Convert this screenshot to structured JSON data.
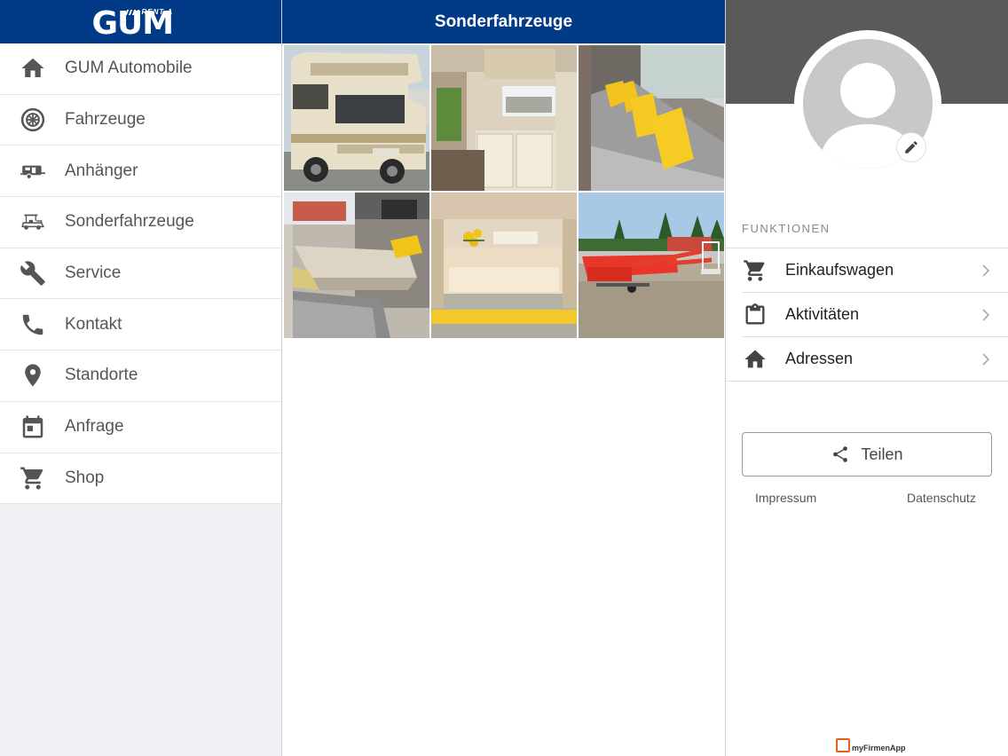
{
  "sidebar": {
    "logo": {
      "brand": "GUM",
      "tagline": "RENT A"
    },
    "items": [
      {
        "label": "GUM Automobile",
        "icon": "home-icon"
      },
      {
        "label": "Fahrzeuge",
        "icon": "wheel-icon"
      },
      {
        "label": "Anhänger",
        "icon": "trailer-icon"
      },
      {
        "label": "Sonderfahrzeuge",
        "icon": "golf-cart-icon"
      },
      {
        "label": "Service",
        "icon": "wrench-icon"
      },
      {
        "label": "Kontakt",
        "icon": "phone-icon"
      },
      {
        "label": "Standorte",
        "icon": "location-pin-icon"
      },
      {
        "label": "Anfrage",
        "icon": "calendar-icon"
      },
      {
        "label": "Shop",
        "icon": "cart-icon"
      }
    ]
  },
  "center": {
    "title": "Sonderfahrzeuge",
    "gallery": [
      {
        "subject": "motorhome-exterior"
      },
      {
        "subject": "motorhome-kitchen"
      },
      {
        "subject": "motorhome-sofa-yellow-cushions"
      },
      {
        "subject": "motorhome-dinette"
      },
      {
        "subject": "motorhome-bed"
      },
      {
        "subject": "red-aerial-work-platform-trailer"
      }
    ]
  },
  "right": {
    "section_title": "FUNKTIONEN",
    "functions": [
      {
        "label": "Einkaufswagen",
        "icon": "cart-icon"
      },
      {
        "label": "Aktivitäten",
        "icon": "clipboard-icon"
      },
      {
        "label": "Adressen",
        "icon": "home-icon"
      }
    ],
    "share_label": "Teilen",
    "impressum_label": "Impressum",
    "datenschutz_label": "Datenschutz",
    "footer_brand": "myFirmenApp"
  },
  "colors": {
    "header_blue": "#013a86",
    "sidebar_bg": "#efeff4",
    "icon_gray": "#555555",
    "profile_bg": "#5a5a5a"
  }
}
